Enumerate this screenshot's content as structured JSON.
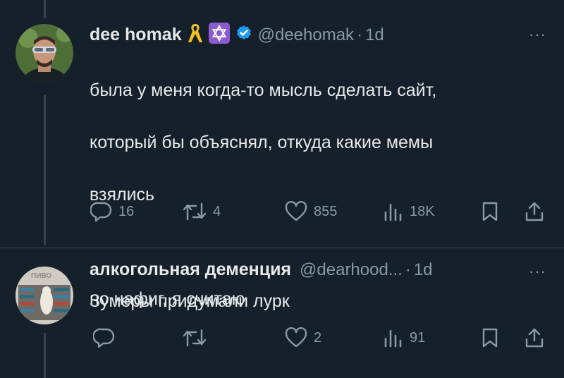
{
  "tweets": [
    {
      "name": "dee homak",
      "handle": "@deehomak",
      "time": "1d",
      "text_lines": [
        "была у меня когда-то мысль сделать сайт,",
        "который бы объяснял, откуда какие мемы",
        "взялись",
        "",
        "но нафиг, я считаю"
      ],
      "badges": [
        "yellow-ribbon-icon",
        "star-of-david-icon",
        "verified-badge-icon"
      ],
      "stats": {
        "replies": "16",
        "retweets": "4",
        "likes": "855",
        "views": "18K"
      }
    },
    {
      "name": "алкогольная деменция",
      "handle": "@dearhood...",
      "time": "1d",
      "text": "Зумеры придумали лурк",
      "avatar_text": "ПИВО",
      "stats": {
        "replies": "",
        "retweets": "",
        "likes": "2",
        "views": "91"
      }
    }
  ],
  "more_label": "···",
  "dot": "·",
  "colors": {
    "background": "#15202b",
    "text": "#e7e9ea",
    "muted": "#8b98a5",
    "verified": "#1d9bf0",
    "divider": "#38444d"
  }
}
